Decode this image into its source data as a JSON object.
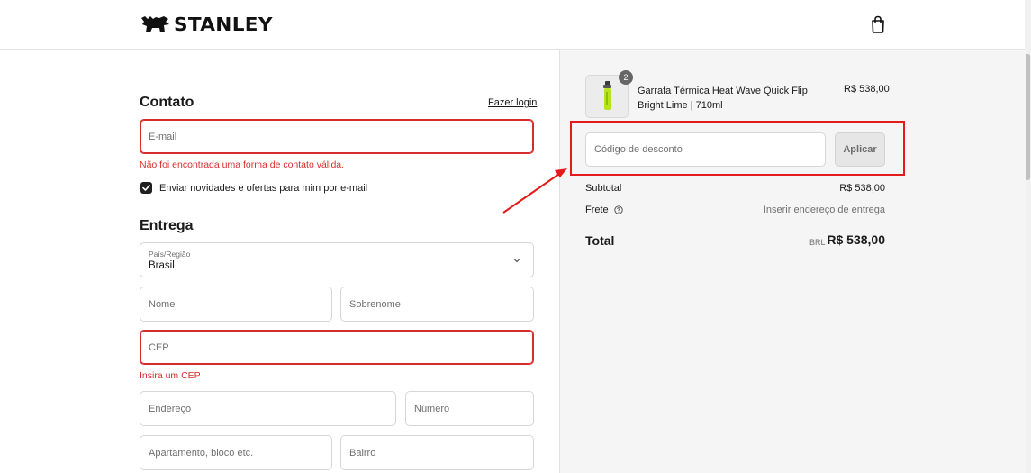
{
  "header": {
    "brand": "STANLEY",
    "cart_icon": "shopping-bag-icon"
  },
  "contact": {
    "title": "Contato",
    "login_link": "Fazer login",
    "email_placeholder": "E-mail",
    "email_error": "Não foi encontrada uma forma de contato válida.",
    "newsletter_label": "Enviar novidades e ofertas para mim por e-mail",
    "newsletter_checked": true
  },
  "delivery": {
    "title": "Entrega",
    "country_label": "País/Região",
    "country_value": "Brasil",
    "first_name_placeholder": "Nome",
    "last_name_placeholder": "Sobrenome",
    "cep_placeholder": "CEP",
    "cep_error": "Insira um CEP",
    "address_placeholder": "Endereço",
    "number_placeholder": "Número",
    "apartment_placeholder": "Apartamento, bloco etc.",
    "neighborhood_placeholder": "Bairro"
  },
  "summary": {
    "product": {
      "quantity": "2",
      "name": "Garrafa Térmica Heat Wave Quick Flip Bright Lime | 710ml",
      "price": "R$ 538,00"
    },
    "discount_placeholder": "Código de desconto",
    "apply_label": "Aplicar",
    "subtotal_label": "Subtotal",
    "subtotal_value": "R$ 538,00",
    "shipping_label": "Frete",
    "shipping_value": "Inserir endereço de entrega",
    "total_label": "Total",
    "currency": "BRL",
    "total_value": "R$ 538,00"
  },
  "colors": {
    "error": "#d72c2c",
    "highlight": "#e31b1b",
    "panel_bg": "#f5f5f5"
  }
}
